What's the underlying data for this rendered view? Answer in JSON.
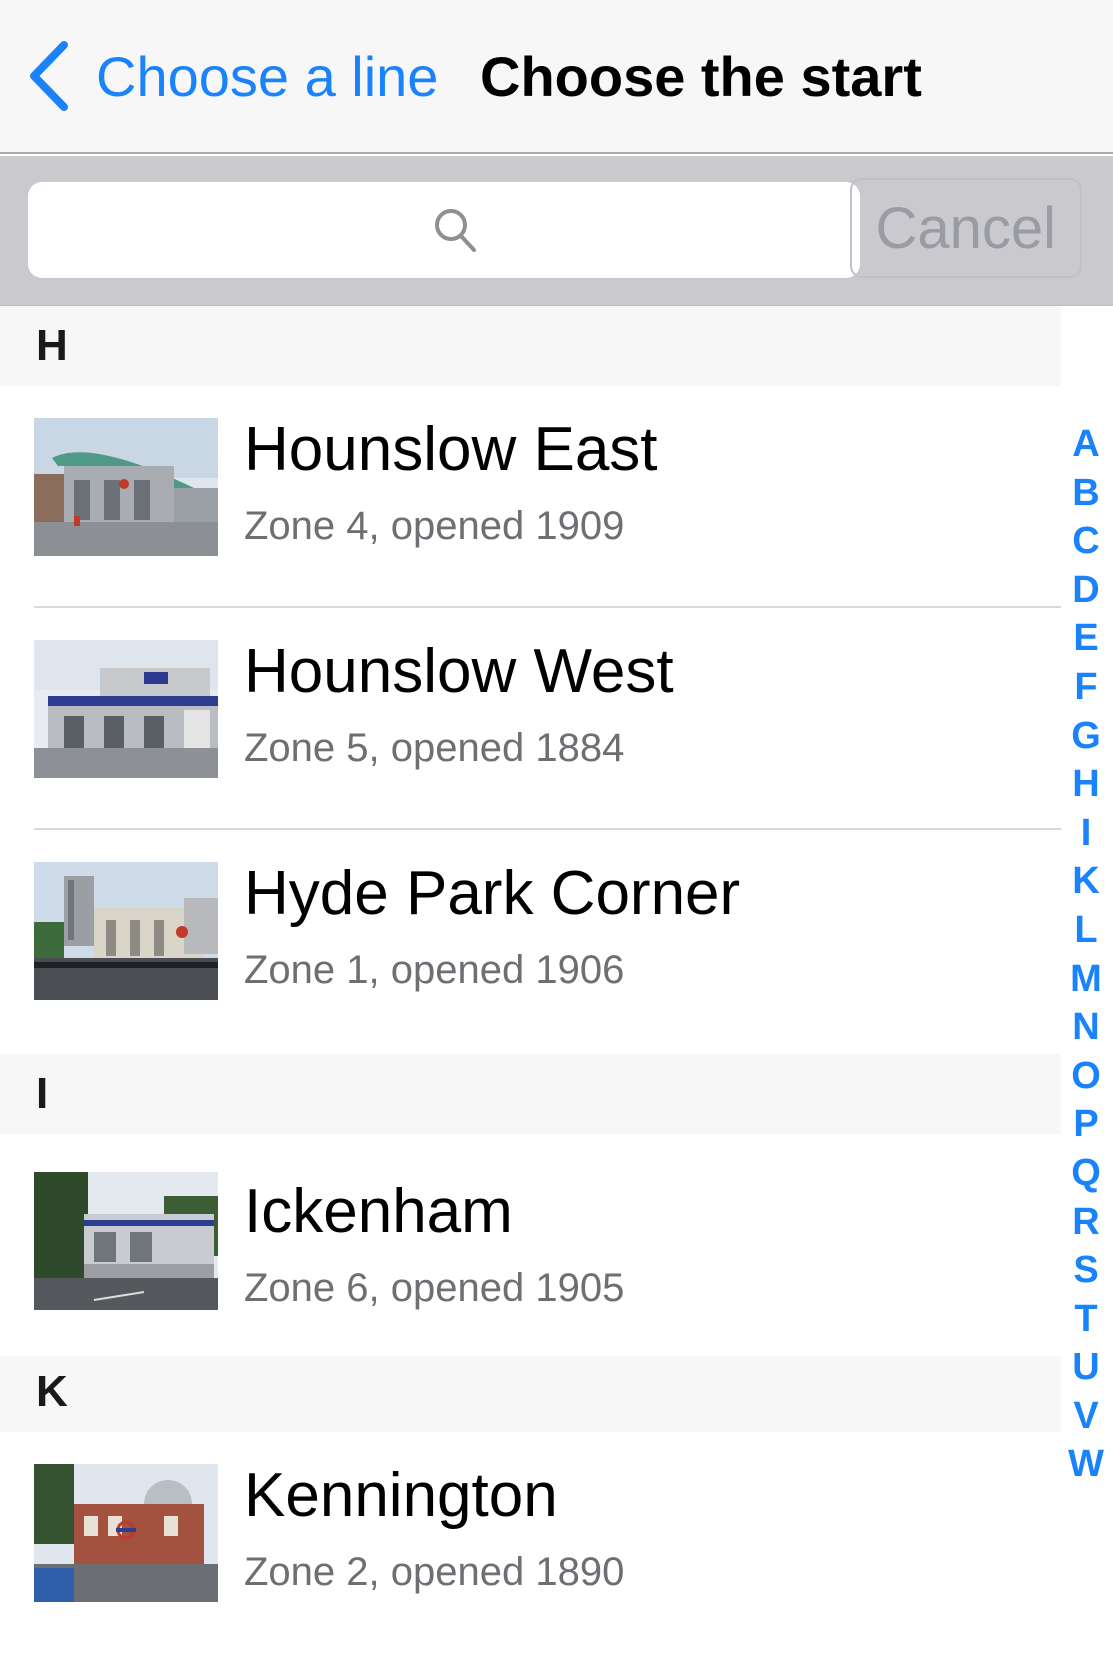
{
  "nav": {
    "back_label": "Choose a line",
    "title": "Choose the start"
  },
  "search": {
    "placeholder": "",
    "value": "",
    "cancel_label": "Cancel"
  },
  "sections": [
    {
      "letter": "H",
      "stations": [
        {
          "name": "Hounslow East",
          "detail": "Zone 4, opened 1909",
          "thumbnail": "station-photo-hounslow-east"
        },
        {
          "name": "Hounslow West",
          "detail": "Zone 5, opened 1884",
          "thumbnail": "station-photo-hounslow-west"
        },
        {
          "name": "Hyde Park Corner",
          "detail": "Zone 1, opened 1906",
          "thumbnail": "station-photo-hyde-park-corner"
        }
      ]
    },
    {
      "letter": "I",
      "stations": [
        {
          "name": "Ickenham",
          "detail": "Zone 6, opened 1905",
          "thumbnail": "station-photo-ickenham"
        }
      ]
    },
    {
      "letter": "K",
      "stations": [
        {
          "name": "Kennington",
          "detail": "Zone 2, opened 1890",
          "thumbnail": "station-photo-kennington"
        }
      ]
    }
  ],
  "index": [
    "A",
    "B",
    "C",
    "D",
    "E",
    "F",
    "G",
    "H",
    "I",
    "K",
    "L",
    "M",
    "N",
    "O",
    "P",
    "Q",
    "R",
    "S",
    "T",
    "U",
    "V",
    "W"
  ],
  "colors": {
    "accent": "#1a82fb",
    "navbar_bg": "#f7f7f7",
    "searchbar_bg": "#c9c9ce",
    "section_bg": "#f7f7f7",
    "detail_text": "#6e6e73"
  }
}
